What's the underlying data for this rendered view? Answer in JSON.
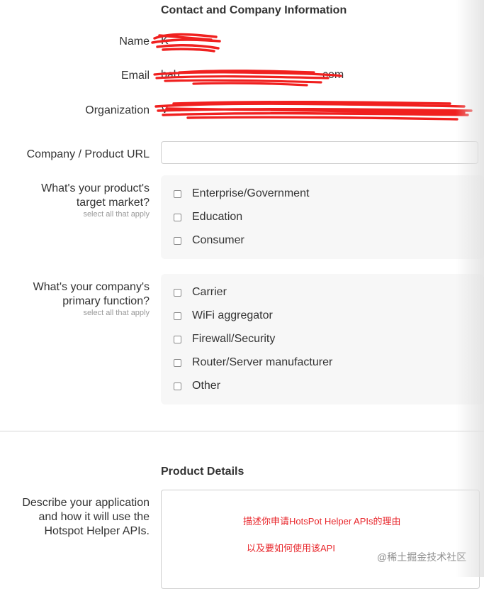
{
  "contact": {
    "title": "Contact and Company Information",
    "name_label": "Name",
    "name_value": "K",
    "email_label": "Email",
    "email_value": "bab",
    "email_value_end": "com",
    "org_label": "Organization",
    "org_value": "V"
  },
  "company_url": {
    "label": "Company / Product URL",
    "value": ""
  },
  "target_market": {
    "label_line1": "What's your product's",
    "label_line2": "target market?",
    "hint": "select all that apply",
    "options": [
      "Enterprise/Government",
      "Education",
      "Consumer"
    ]
  },
  "primary_function": {
    "label_line1": "What's your company's",
    "label_line2": "primary function?",
    "hint": "select all that apply",
    "options": [
      "Carrier",
      "WiFi aggregator",
      "Firewall/Security",
      "Router/Server manufacturer",
      "Other"
    ]
  },
  "product": {
    "title": "Product Details",
    "describe_line1": "Describe your application",
    "describe_line2": "and how it will use the",
    "describe_line3": "Hotspot Helper APIs."
  },
  "annotation": {
    "line1": "描述你申请HotsPot Helper APIs的理由",
    "line2": "以及要如何使用该API"
  },
  "watermark": "@稀土掘金技术社区",
  "colors": {
    "scribble": "#f0201f",
    "annotation": "#e8262b",
    "panel": "#f7f7f7"
  }
}
